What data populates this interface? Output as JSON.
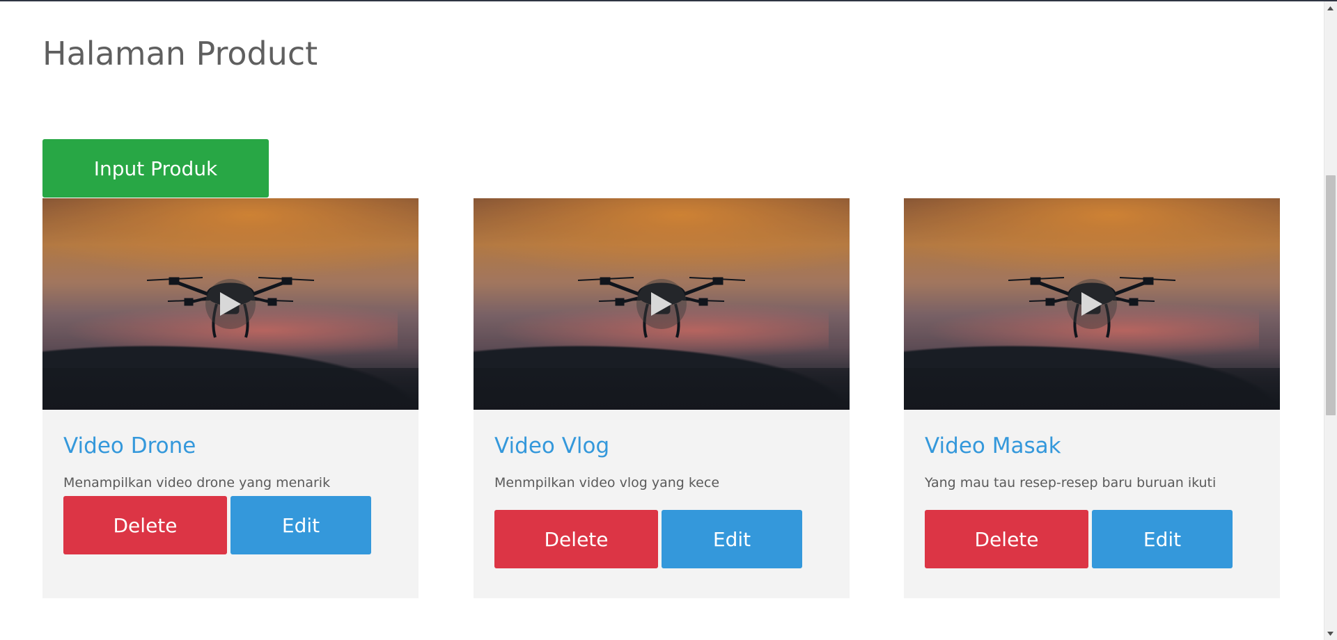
{
  "page": {
    "title": "Halaman Product"
  },
  "toolbar": {
    "input_label": "Input Produk"
  },
  "products": [
    {
      "title": "Video Drone",
      "description": "Menampilkan video drone yang menarik",
      "delete_label": "Delete",
      "edit_label": "Edit"
    },
    {
      "title": "Video Vlog",
      "description": "Menmpilkan video vlog yang kece",
      "delete_label": "Delete",
      "edit_label": "Edit"
    },
    {
      "title": "Video Masak",
      "description": "Yang mau tau resep-resep baru buruan ikuti",
      "delete_label": "Delete",
      "edit_label": "Edit"
    }
  ],
  "icons": {
    "play": "play-icon",
    "scroll_up": "chevron-up-icon",
    "scroll_down": "chevron-down-icon"
  },
  "colors": {
    "primary_green": "#28a745",
    "danger_red": "#dc3545",
    "info_blue": "#3498db",
    "card_background": "#f3f3f3"
  }
}
